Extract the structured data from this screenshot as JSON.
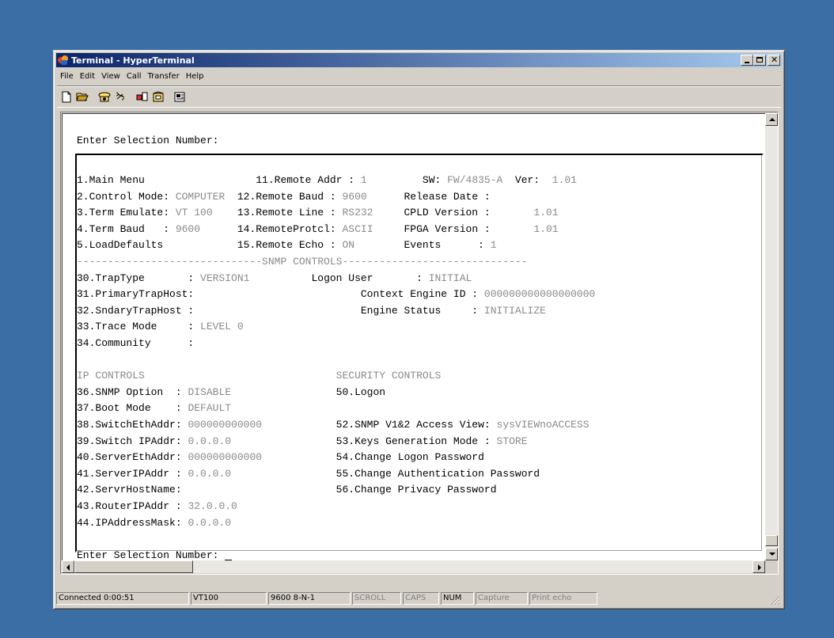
{
  "window": {
    "title": "Terminal - HyperTerminal"
  },
  "menu": [
    "File",
    "Edit",
    "View",
    "Call",
    "Transfer",
    "Help"
  ],
  "toolbar": [
    "new-icon",
    "open-icon",
    "connect-icon",
    "disconnect-icon",
    "send-icon",
    "receive-icon",
    "properties-icon"
  ],
  "screen": {
    "header_prompt": "Enter Selection Number:",
    "rows": [
      [
        {
          "t": "1.Main Menu"
        },
        {
          "t": "                  11.Remote Addr : "
        },
        {
          "t": "1",
          "g": true
        },
        {
          "t": "         SW: "
        },
        {
          "t": "FW/4835-A",
          "g": true
        },
        {
          "t": "  Ver:  "
        },
        {
          "t": "1.01",
          "g": true
        }
      ],
      [
        {
          "t": "2.Control Mode: "
        },
        {
          "t": "COMPUTER",
          "g": true
        },
        {
          "t": "  12.Remote Baud : "
        },
        {
          "t": "9600",
          "g": true
        },
        {
          "t": "      Release Date :"
        }
      ],
      [
        {
          "t": "3.Term Emulate: "
        },
        {
          "t": "VT 100",
          "g": true
        },
        {
          "t": "    13.Remote Line : "
        },
        {
          "t": "RS232",
          "g": true
        },
        {
          "t": "     CPLD Version :       "
        },
        {
          "t": "1.01",
          "g": true
        }
      ],
      [
        {
          "t": "4.Term Baud   : "
        },
        {
          "t": "9600",
          "g": true
        },
        {
          "t": "      14.RemoteProtcl: "
        },
        {
          "t": "ASCII",
          "g": true
        },
        {
          "t": "     FPGA Version :       "
        },
        {
          "t": "1.01",
          "g": true
        }
      ],
      [
        {
          "t": "5.LoadDefaults"
        },
        {
          "t": "            15.Remote Echo : "
        },
        {
          "t": "ON",
          "g": true
        },
        {
          "t": "        Events      : "
        },
        {
          "t": "1",
          "g": true
        }
      ],
      [
        {
          "t": "------------------------------",
          "g": true
        },
        {
          "t": "SNMP CONTROLS",
          "g": true
        },
        {
          "t": "------------------------------",
          "g": true
        }
      ],
      [
        {
          "t": "30.TrapType       : "
        },
        {
          "t": "VERSION1",
          "g": true
        },
        {
          "t": "          Logon User       : "
        },
        {
          "t": "INITIAL",
          "g": true
        }
      ],
      [
        {
          "t": "31.PrimaryTrapHost:"
        },
        {
          "t": "                           Context Engine ID : "
        },
        {
          "t": "000000000000000000",
          "g": true
        }
      ],
      [
        {
          "t": "32.SndaryTrapHost :"
        },
        {
          "t": "                           Engine Status     : "
        },
        {
          "t": "INITIALIZE",
          "g": true
        }
      ],
      [
        {
          "t": "33.Trace Mode     : "
        },
        {
          "t": "LEVEL 0",
          "g": true
        }
      ],
      [
        {
          "t": "34.Community      :"
        }
      ],
      [
        {
          "t": ""
        }
      ],
      [
        {
          "t": "IP CONTROLS",
          "g": true
        },
        {
          "t": "                               "
        },
        {
          "t": "SECURITY CONTROLS",
          "g": true
        }
      ],
      [
        {
          "t": "36.SNMP Option  : "
        },
        {
          "t": "DISABLE",
          "g": true
        },
        {
          "t": "                 50.Logon"
        }
      ],
      [
        {
          "t": "37.Boot Mode    : "
        },
        {
          "t": "DEFAULT",
          "g": true
        }
      ],
      [
        {
          "t": "38.SwitchEthAddr: "
        },
        {
          "t": "000000000000",
          "g": true
        },
        {
          "t": "            52.SNMP V1&2 Access View: "
        },
        {
          "t": "sysVIEWnoACCESS",
          "g": true
        }
      ],
      [
        {
          "t": "39.Switch IPAddr: "
        },
        {
          "t": "0.0.0.0",
          "g": true
        },
        {
          "t": "                 53.Keys Generation Mode : "
        },
        {
          "t": "STORE",
          "g": true
        }
      ],
      [
        {
          "t": "40.ServerEthAddr: "
        },
        {
          "t": "000000000000",
          "g": true
        },
        {
          "t": "            54.Change Logon Password"
        }
      ],
      [
        {
          "t": "41.ServerIPAddr : "
        },
        {
          "t": "0.0.0.0",
          "g": true
        },
        {
          "t": "                 55.Change Authentication Password"
        }
      ],
      [
        {
          "t": "42.ServrHostName:"
        },
        {
          "t": "                         56.Change Privacy Password"
        }
      ],
      [
        {
          "t": "43.RouterIPAddr : "
        },
        {
          "t": "32.0.0.0",
          "g": true
        }
      ],
      [
        {
          "t": "44.IPAddressMask: "
        },
        {
          "t": "0.0.0.0",
          "g": true
        }
      ],
      [
        {
          "t": ""
        }
      ],
      [
        {
          "t": "Enter Selection Number: "
        }
      ]
    ]
  },
  "status": {
    "connected": "Connected 0:00:51",
    "emulation": "VT100",
    "settings": "9600 8-N-1",
    "scroll": "SCROLL",
    "caps": "CAPS",
    "num": "NUM",
    "capture": "Capture",
    "print_echo": "Print echo"
  }
}
